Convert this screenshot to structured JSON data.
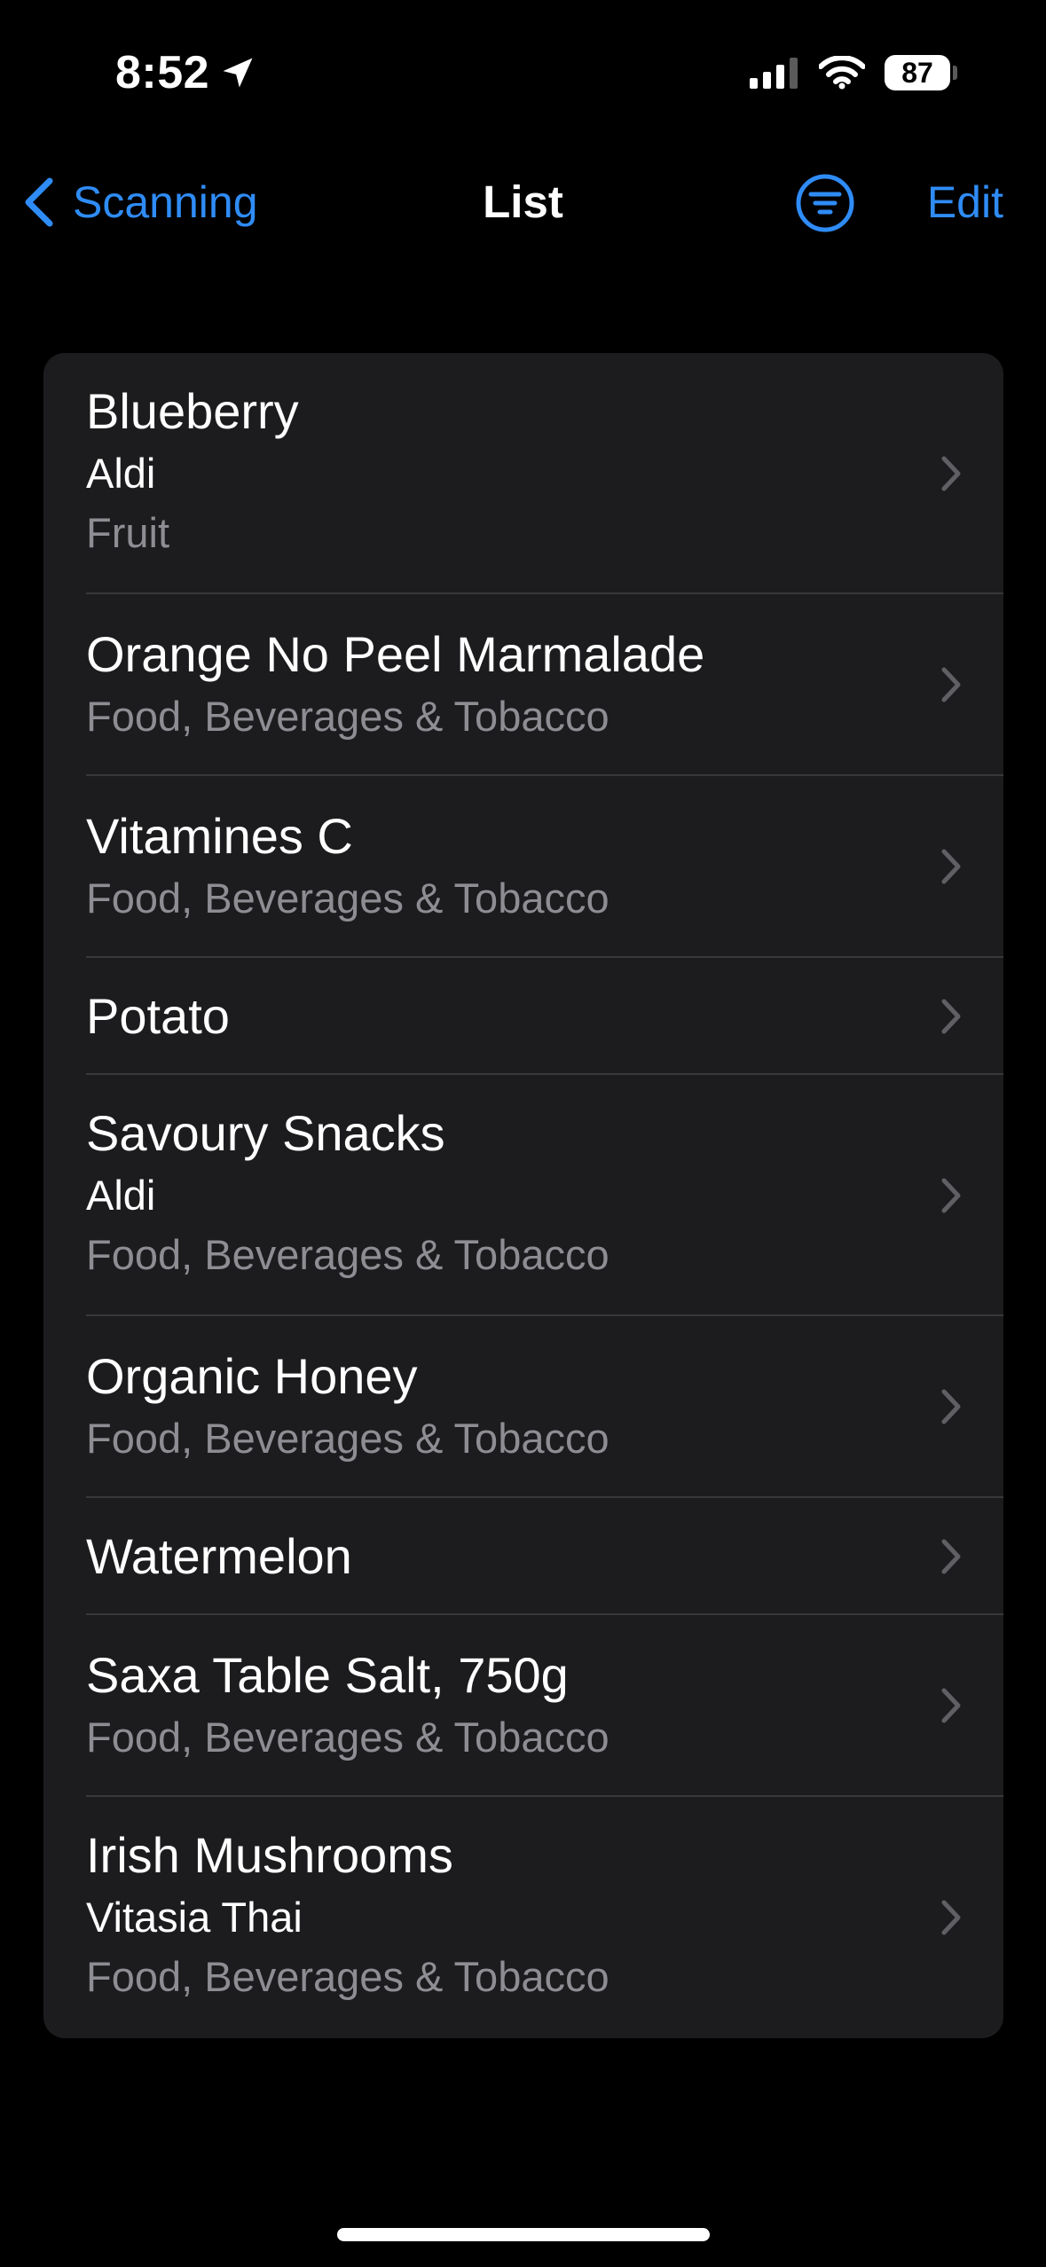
{
  "status_bar": {
    "time": "8:52",
    "battery_level": "87"
  },
  "nav": {
    "back_label": "Scanning",
    "title": "List",
    "edit_label": "Edit"
  },
  "colors": {
    "accent": "#2f8cf6",
    "background": "#000000",
    "card": "#1c1c1e",
    "secondary_text": "#8d8d93"
  },
  "items": [
    {
      "title": "Blueberry",
      "store": "Aldi",
      "category": "Fruit"
    },
    {
      "title": "Orange No Peel Marmalade",
      "category": "Food, Beverages & Tobacco"
    },
    {
      "title": "Vitamines C",
      "category": "Food, Beverages & Tobacco"
    },
    {
      "title": "Potato"
    },
    {
      "title": "Savoury Snacks",
      "store": "Aldi",
      "category": "Food, Beverages & Tobacco"
    },
    {
      "title": "Organic Honey",
      "category": "Food, Beverages & Tobacco"
    },
    {
      "title": "Watermelon"
    },
    {
      "title": "Saxa Table Salt, 750g",
      "category": "Food, Beverages & Tobacco"
    },
    {
      "title": "Irish Mushrooms",
      "store": "Vitasia Thai",
      "category": "Food, Beverages & Tobacco"
    }
  ]
}
